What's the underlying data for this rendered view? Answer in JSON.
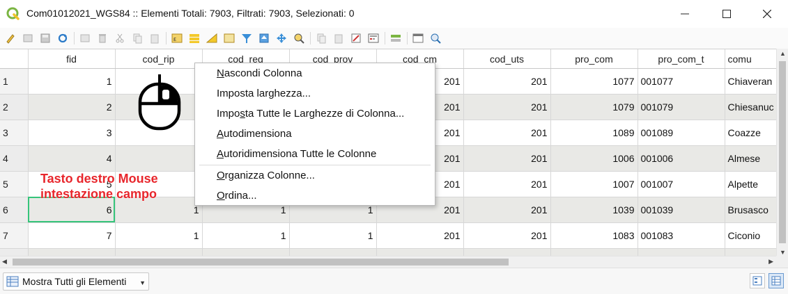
{
  "window": {
    "title": "Com01012021_WGS84 :: Elementi Totali: 7903, Filtrati: 7903, Selezionati: 0",
    "app_icon": "qgis-logo-icon",
    "controls": [
      "minimize-icon",
      "maximize-icon",
      "close-icon"
    ]
  },
  "toolbar": {
    "icons": [
      "pencil-edit-icon",
      "multi-edit-icon",
      "save-edits-icon",
      "reload-icon",
      "add-feature-icon",
      "delete-feature-icon",
      "cut-icon",
      "copy-icon",
      "paste-icon",
      "expression-select-icon",
      "select-all-icon",
      "invert-selection-icon",
      "deselect-icon",
      "filter-select-icon",
      "move-to-top-icon",
      "pan-to-selection-icon",
      "zoom-to-selection-icon",
      "copy-rows-icon",
      "paste-rows-icon",
      "delete-field-icon",
      "field-calculator-icon",
      "conditional-format-icon",
      "dock-icon",
      "actions-icon"
    ]
  },
  "table": {
    "columns": [
      "fid",
      "cod_rip",
      "cod_reg",
      "cod_prov",
      "cod_cm",
      "cod_uts",
      "pro_com",
      "pro_com_t",
      "comu"
    ],
    "rows": [
      {
        "n": "1",
        "fid": "1",
        "cod_rip": "",
        "cod_reg": "",
        "cod_prov": "",
        "cod_cm": "201",
        "cod_uts": "201",
        "pro_com": "1077",
        "pro_com_t": "001077",
        "comu": "Chiaveran"
      },
      {
        "n": "2",
        "fid": "2",
        "cod_rip": "",
        "cod_reg": "",
        "cod_prov": "",
        "cod_cm": "201",
        "cod_uts": "201",
        "pro_com": "1079",
        "pro_com_t": "001079",
        "comu": "Chiesanuc"
      },
      {
        "n": "3",
        "fid": "3",
        "cod_rip": "",
        "cod_reg": "",
        "cod_prov": "",
        "cod_cm": "201",
        "cod_uts": "201",
        "pro_com": "1089",
        "pro_com_t": "001089",
        "comu": "Coazze"
      },
      {
        "n": "4",
        "fid": "4",
        "cod_rip": "",
        "cod_reg": "",
        "cod_prov": "",
        "cod_cm": "201",
        "cod_uts": "201",
        "pro_com": "1006",
        "pro_com_t": "001006",
        "comu": "Almese"
      },
      {
        "n": "5",
        "fid": "5",
        "cod_rip": "",
        "cod_reg": "",
        "cod_prov": "",
        "cod_cm": "201",
        "cod_uts": "201",
        "pro_com": "1007",
        "pro_com_t": "001007",
        "comu": "Alpette"
      },
      {
        "n": "6",
        "fid": "6",
        "cod_rip": "1",
        "cod_reg": "1",
        "cod_prov": "1",
        "cod_cm": "201",
        "cod_uts": "201",
        "pro_com": "1039",
        "pro_com_t": "001039",
        "comu": "Brusasco"
      },
      {
        "n": "7",
        "fid": "7",
        "cod_rip": "1",
        "cod_reg": "1",
        "cod_prov": "1",
        "cod_cm": "201",
        "cod_uts": "201",
        "pro_com": "1083",
        "pro_com_t": "001083",
        "comu": "Ciconio"
      }
    ]
  },
  "context_menu": {
    "items": [
      {
        "label": "Nascondi Colonna",
        "accel": "N"
      },
      {
        "label": "Imposta larghezza...",
        "accel": ""
      },
      {
        "label": "Imposta Tutte le Larghezze di Colonna...",
        "accel": "s"
      },
      {
        "label": "Autodimensiona",
        "accel": "A"
      },
      {
        "label": "Autoridimensiona Tutte le Colonne",
        "accel": "A"
      },
      {
        "label": "Organizza Colonne...",
        "accel": "O"
      },
      {
        "label": "Ordina...",
        "accel": "O"
      }
    ]
  },
  "annotation": {
    "line1": "Tasto destro Mouse",
    "line2": "intestazione campo",
    "color": "#e8262c"
  },
  "bottombar": {
    "filter_label": "Mostra Tutti gli Elementi",
    "views": [
      "form-view-icon",
      "table-view-icon"
    ]
  }
}
